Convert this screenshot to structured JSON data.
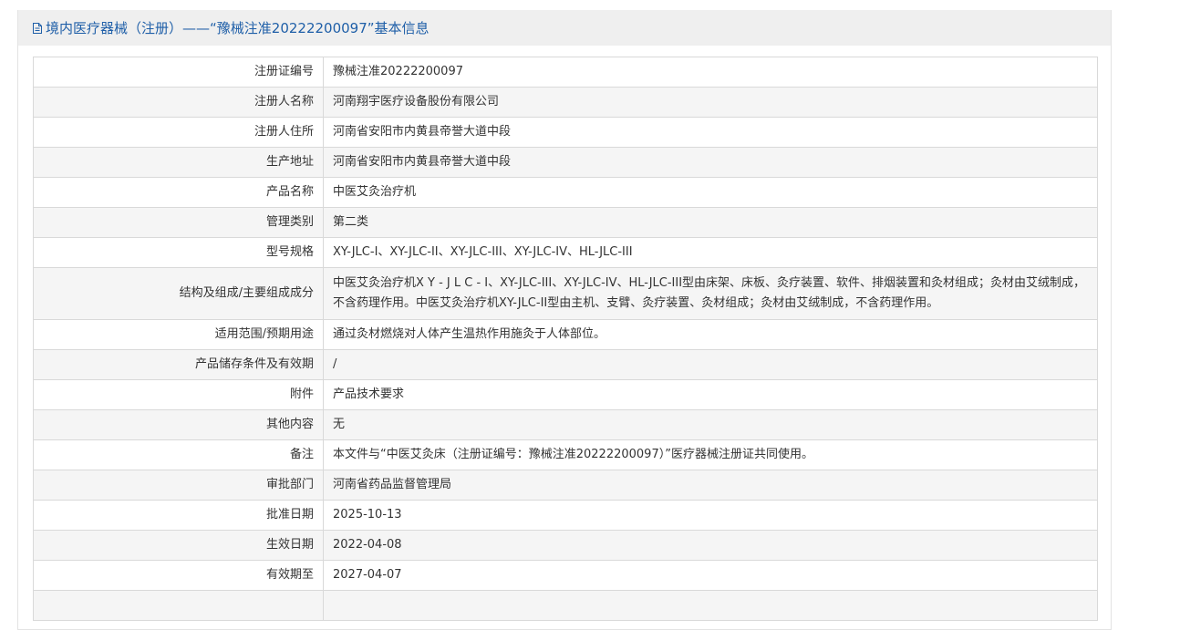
{
  "header": {
    "title": "境内医疗器械（注册）——“豫械注准20222200097”基本信息",
    "icon": "document-icon",
    "accent_color": "#1f5fa8"
  },
  "rows": [
    {
      "label": "注册证编号",
      "value": "豫械注准20222200097"
    },
    {
      "label": "注册人名称",
      "value": "河南翔宇医疗设备股份有限公司"
    },
    {
      "label": "注册人住所",
      "value": "河南省安阳市内黄县帝誉大道中段"
    },
    {
      "label": "生产地址",
      "value": "河南省安阳市内黄县帝誉大道中段"
    },
    {
      "label": "产品名称",
      "value": "中医艾灸治疗机"
    },
    {
      "label": "管理类别",
      "value": "第二类"
    },
    {
      "label": "型号规格",
      "value": "XY-JLC-I、XY-JLC-II、XY-JLC-III、XY-JLC-IV、HL-JLC-III"
    },
    {
      "label": "结构及组成/主要组成成分",
      "value": "中医艾灸治疗机X Y - J L C - I、XY-JLC-III、XY-JLC-IV、HL-JLC-III型由床架、床板、灸疗装置、软件、排烟装置和灸材组成；灸材由艾绒制成，不含药理作用。中医艾灸治疗机XY-JLC-II型由主机、支臂、灸疗装置、灸材组成；灸材由艾绒制成，不含药理作用。"
    },
    {
      "label": "适用范围/预期用途",
      "value": "通过灸材燃烧对人体产生温热作用施灸于人体部位。"
    },
    {
      "label": "产品储存条件及有效期",
      "value": "/"
    },
    {
      "label": "附件",
      "value": "产品技术要求"
    },
    {
      "label": "其他内容",
      "value": "无"
    },
    {
      "label": "备注",
      "value": "本文件与“中医艾灸床（注册证编号：豫械注准20222200097）”医疗器械注册证共同使用。"
    },
    {
      "label": "审批部门",
      "value": "河南省药品监督管理局"
    },
    {
      "label": "批准日期",
      "value": "2025-10-13"
    },
    {
      "label": "生效日期",
      "value": "2022-04-08"
    },
    {
      "label": "有效期至",
      "value": "2027-04-07"
    },
    {
      "label": "",
      "value": ""
    }
  ]
}
